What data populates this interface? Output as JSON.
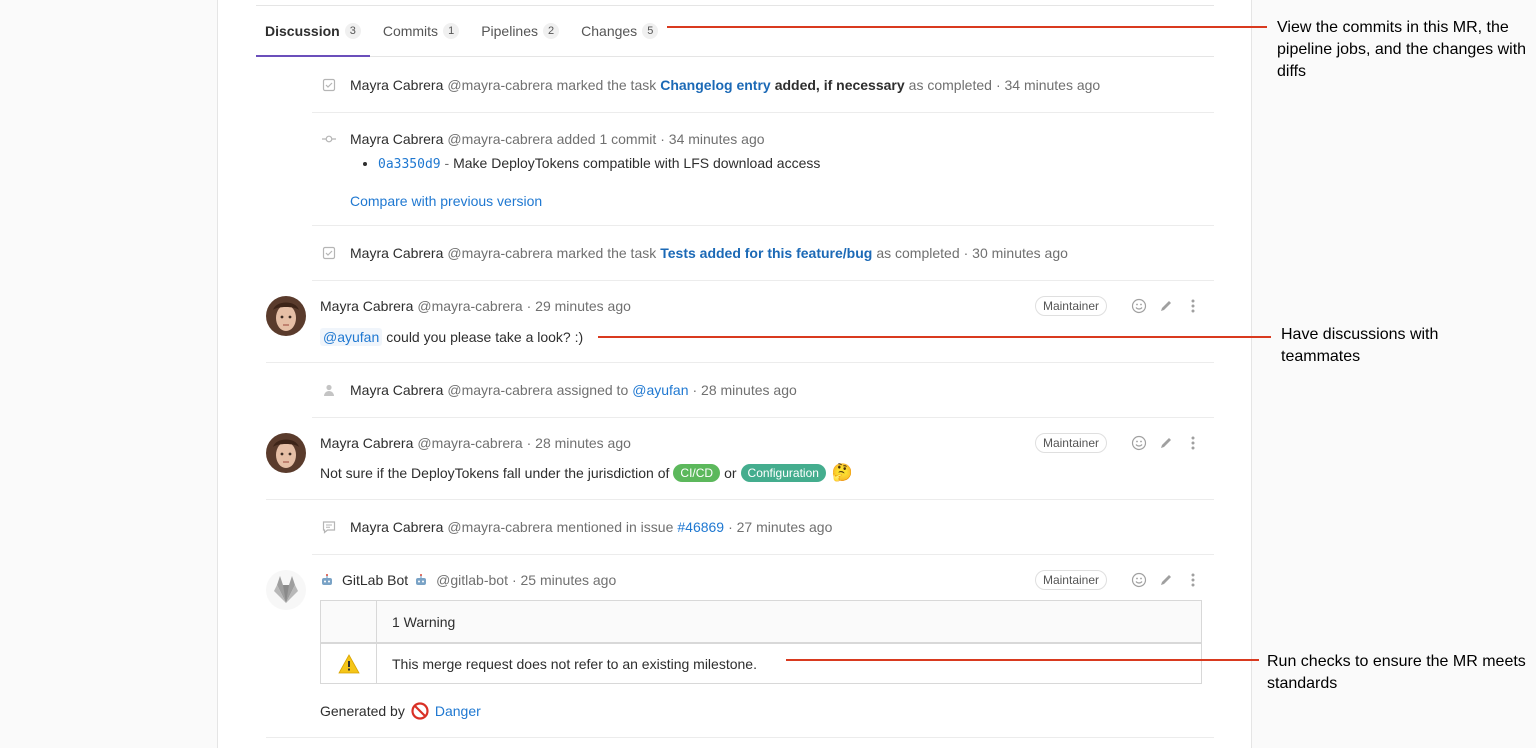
{
  "tabs": [
    {
      "label": "Discussion",
      "count": "3"
    },
    {
      "label": "Commits",
      "count": "1"
    },
    {
      "label": "Pipelines",
      "count": "2"
    },
    {
      "label": "Changes",
      "count": "5"
    }
  ],
  "events": {
    "task1": {
      "author": "Mayra Cabrera",
      "handle": "@mayra-cabrera",
      "action": "marked the task",
      "task_link": "Changelog entry",
      "task_rest": "added, if necessary",
      "suffix": "as completed",
      "time": "· 34 minutes ago"
    },
    "commit": {
      "author": "Mayra Cabrera",
      "handle": "@mayra-cabrera",
      "action": "added 1 commit",
      "time": "· 34 minutes ago",
      "sha": "0a3350d9",
      "dash": " - ",
      "message": "Make DeployTokens compatible with LFS download access",
      "compare": "Compare with previous version"
    },
    "task2": {
      "author": "Mayra Cabrera",
      "handle": "@mayra-cabrera",
      "action": "marked the task",
      "task_link": "Tests added for this feature/bug",
      "suffix": "as completed",
      "time": "· 30 minutes ago"
    },
    "assigned": {
      "author": "Mayra Cabrera",
      "handle": "@mayra-cabrera",
      "action": "assigned to",
      "assignee": "@ayufan",
      "time": "· 28 minutes ago"
    },
    "mentioned": {
      "author": "Mayra Cabrera",
      "handle": "@mayra-cabrera",
      "action": "mentioned in issue",
      "issue": "#46869",
      "time": "· 27 minutes ago"
    }
  },
  "notes": {
    "n1": {
      "author": "Mayra Cabrera",
      "handle": "@mayra-cabrera",
      "time": "· 29 minutes ago",
      "role": "Maintainer",
      "mention": "@ayufan",
      "text": "could you please take a look? :)"
    },
    "n2": {
      "author": "Mayra Cabrera",
      "handle": "@mayra-cabrera",
      "time": "· 28 minutes ago",
      "role": "Maintainer",
      "text_before": "Not sure if the DeployTokens fall under the jurisdiction of",
      "label1": "CI/CD",
      "label1_color": "#5cb85c",
      "conj": "or",
      "label2": "Configuration",
      "label2_color": "#44ad8e",
      "emoji": "🤔"
    },
    "bot": {
      "author": "GitLab Bot",
      "handle": "@gitlab-bot",
      "time": "· 25 minutes ago",
      "role": "Maintainer",
      "table_header": "1 Warning",
      "warning_text": "This merge request does not refer to an existing milestone.",
      "generated_by": "Generated by",
      "generator": "Danger"
    }
  },
  "callouts": {
    "tabs_note": "View the commits in this MR, the pipeline jobs, and the changes with diffs",
    "discuss_note": "Have discussions with teammates",
    "checks_note": "Run checks to ensure the MR meets standards"
  },
  "colors": {
    "accent": "#6b4fbb",
    "link": "#1f78d1",
    "callout_line": "#d93a1f"
  }
}
